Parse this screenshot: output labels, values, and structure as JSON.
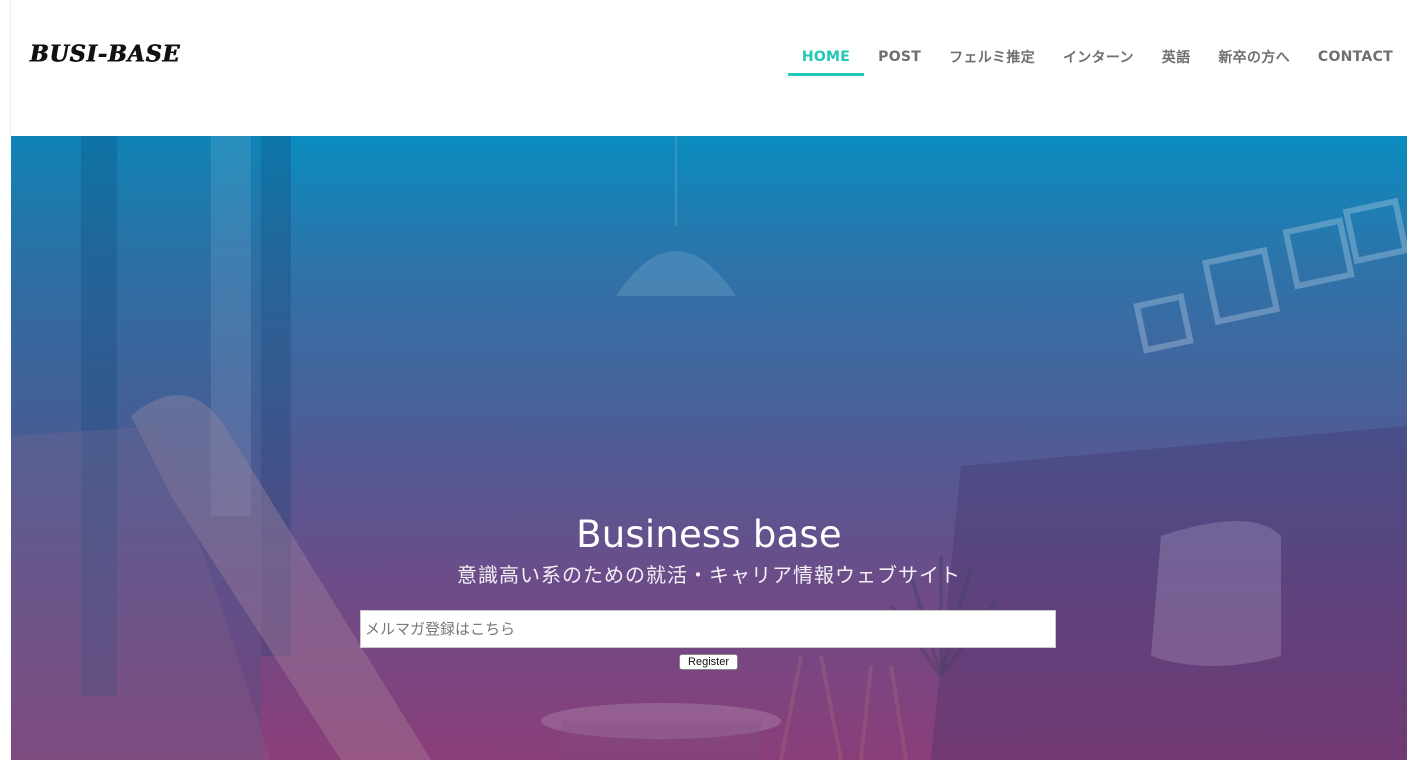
{
  "header": {
    "logo_text": "BUSI-BASE",
    "nav": [
      {
        "label": "HOME",
        "active": true
      },
      {
        "label": "POST",
        "active": false
      },
      {
        "label": "フェルミ推定",
        "active": false
      },
      {
        "label": "インターン",
        "active": false
      },
      {
        "label": "英語",
        "active": false
      },
      {
        "label": "新卒の方へ",
        "active": false
      },
      {
        "label": "CONTACT",
        "active": false
      }
    ]
  },
  "hero": {
    "title": "Business base",
    "subtitle": "意識高い系のための就活・キャリア情報ウェブサイト",
    "email_placeholder": "メルマガ登録はこちら",
    "register_label": "Register"
  },
  "colors": {
    "accent": "#1ec8b4",
    "nav_text": "#6f6f6f",
    "hero_gradient_top": "#0a8cbf",
    "hero_gradient_bottom": "#8a3e79"
  }
}
